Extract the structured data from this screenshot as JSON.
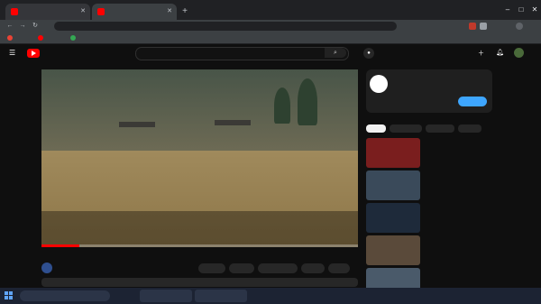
{
  "browser": {
    "tabs": [
      {
        "label": "",
        "active": false
      },
      {
        "label": "",
        "active": true
      }
    ],
    "address": "",
    "bookmarks": [
      "",
      "",
      ""
    ],
    "bookmarks_right": ""
  },
  "youtube": {
    "logo_word": "",
    "search_placeholder": ""
  },
  "player": {
    "title_overlay": "",
    "caption": "",
    "progress_fraction": 0.12
  },
  "video": {
    "title": "",
    "channel_name": "",
    "actions": [
      "",
      "",
      "",
      "",
      ""
    ]
  },
  "sidebar": {
    "ad": {
      "headline": "",
      "sub": "",
      "cta": ""
    },
    "chips": [
      {
        "label": "",
        "on": true
      },
      {
        "label": "",
        "on": false
      },
      {
        "label": "",
        "on": false
      },
      {
        "label": "",
        "on": false
      }
    ],
    "recs": [
      {
        "title": "",
        "meta": "",
        "duration": "",
        "thumb": "#7a1e1e"
      },
      {
        "title": "",
        "meta": "",
        "duration": "",
        "thumb": "#3a4a5a"
      },
      {
        "title": "",
        "meta": "",
        "duration": "",
        "thumb": "#1e2a3a"
      },
      {
        "title": "",
        "meta": "",
        "duration": "",
        "thumb": "#5a4a3a"
      },
      {
        "title": "",
        "meta": "",
        "duration": "",
        "thumb": "#4a5a6a"
      }
    ]
  },
  "taskbar": {
    "search": "",
    "apps": [
      "",
      ""
    ],
    "clock_time": "",
    "clock_date": ""
  },
  "watermark": ""
}
